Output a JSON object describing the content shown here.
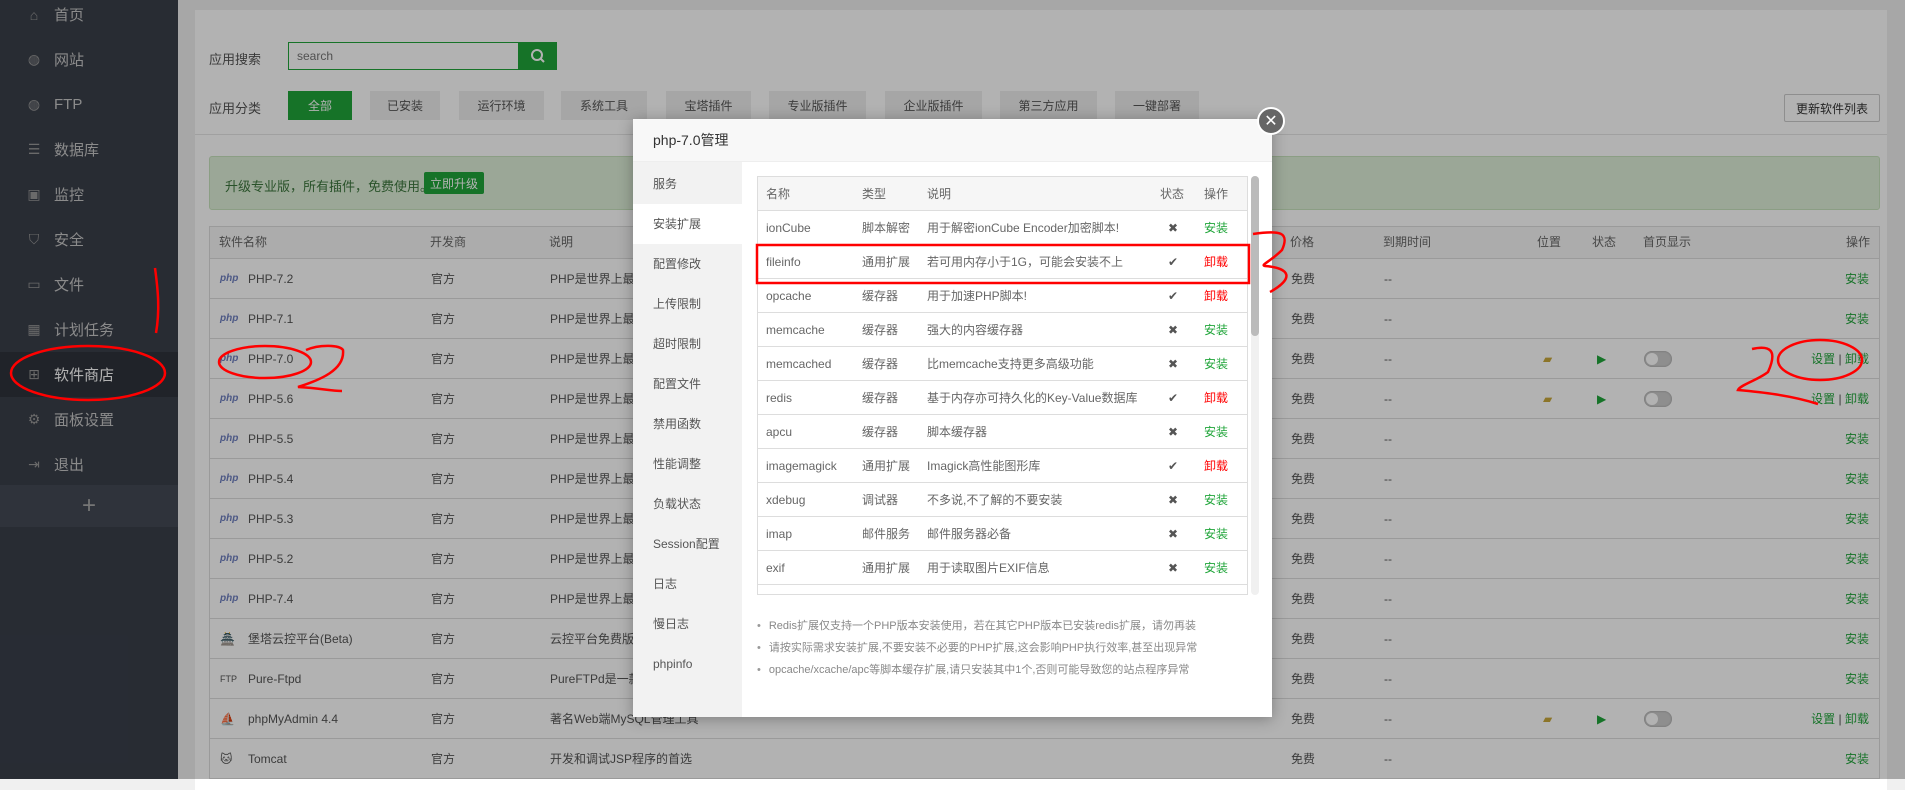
{
  "sidebar": {
    "items": [
      {
        "label": "首页",
        "icon": "home-icon",
        "glyph": "⌂"
      },
      {
        "label": "网站",
        "icon": "globe-icon",
        "glyph": "◍"
      },
      {
        "label": "FTP",
        "icon": "ftp-icon",
        "glyph": "◍"
      },
      {
        "label": "数据库",
        "icon": "database-icon",
        "glyph": "☰"
      },
      {
        "label": "监控",
        "icon": "monitor-icon",
        "glyph": "▣"
      },
      {
        "label": "安全",
        "icon": "shield-icon",
        "glyph": "⛉"
      },
      {
        "label": "文件",
        "icon": "folder-icon",
        "glyph": "▭"
      },
      {
        "label": "计划任务",
        "icon": "calendar-icon",
        "glyph": "▦"
      },
      {
        "label": "软件商店",
        "icon": "apps-grid-icon",
        "glyph": "⊞",
        "active": true
      },
      {
        "label": "面板设置",
        "icon": "gear-icon",
        "glyph": "⚙"
      },
      {
        "label": "退出",
        "icon": "logout-icon",
        "glyph": "⇥"
      }
    ],
    "add_label": "+"
  },
  "search": {
    "label": "应用搜索",
    "placeholder": "search"
  },
  "categories": {
    "label": "应用分类",
    "items": [
      "全部",
      "已安装",
      "运行环境",
      "系统工具",
      "宝塔插件",
      "专业版插件",
      "企业版插件",
      "第三方应用",
      "一键部署"
    ],
    "active": "全部"
  },
  "update_button": "更新软件列表",
  "banner": {
    "text": "升级专业版，所有插件，免费使用。",
    "button": "立即升级"
  },
  "table": {
    "headers": {
      "name": "软件名称",
      "developer": "开发商",
      "description": "说明",
      "price": "价格",
      "expiry": "到期时间",
      "location": "位置",
      "status": "状态",
      "homepage": "首页显示",
      "action": "操作"
    },
    "rows": [
      {
        "icon": "php",
        "name": "PHP-7.2",
        "developer": "官方",
        "description": "PHP是世界上最",
        "price": "免费",
        "expiry": "--",
        "action": "安装"
      },
      {
        "icon": "php",
        "name": "PHP-7.1",
        "developer": "官方",
        "description": "PHP是世界上最",
        "price": "免费",
        "expiry": "--",
        "action": "安装"
      },
      {
        "icon": "php",
        "name": "PHP-7.0",
        "developer": "官方",
        "description": "PHP是世界上最",
        "price": "免费",
        "expiry": "--",
        "installed": true,
        "settings": "设置",
        "uninstall": "卸载"
      },
      {
        "icon": "php",
        "name": "PHP-5.6",
        "developer": "官方",
        "description": "PHP是世界上最",
        "price": "免费",
        "expiry": "--",
        "installed": true,
        "settings": "设置",
        "uninstall": "卸载"
      },
      {
        "icon": "php",
        "name": "PHP-5.5",
        "developer": "官方",
        "description": "PHP是世界上最",
        "price": "免费",
        "expiry": "--",
        "action": "安装"
      },
      {
        "icon": "php",
        "name": "PHP-5.4",
        "developer": "官方",
        "description": "PHP是世界上最",
        "price": "免费",
        "expiry": "--",
        "action": "安装"
      },
      {
        "icon": "php",
        "name": "PHP-5.3",
        "developer": "官方",
        "description": "PHP是世界上最",
        "price": "免费",
        "expiry": "--",
        "action": "安装"
      },
      {
        "icon": "php",
        "name": "PHP-5.2",
        "developer": "官方",
        "description": "PHP是世界上最",
        "price": "免费",
        "expiry": "--",
        "action": "安装"
      },
      {
        "icon": "php",
        "name": "PHP-7.4",
        "developer": "官方",
        "description": "PHP是世界上最",
        "price": "免费",
        "expiry": "--",
        "action": "安装"
      },
      {
        "icon": "pagoda",
        "name": "堡塔云控平台(Beta)",
        "developer": "官方",
        "description": "云控平台免费版",
        "price": "免费",
        "expiry": "--",
        "action": "安装"
      },
      {
        "icon": "ftp",
        "name": "Pure-Ftpd",
        "developer": "官方",
        "description": "PureFTPd是一款",
        "price": "免费",
        "expiry": "--",
        "action": "安装"
      },
      {
        "icon": "phpmyadmin",
        "name": "phpMyAdmin 4.4",
        "developer": "官方",
        "description": "著名Web端MySQL管理工具",
        "price": "免费",
        "expiry": "--",
        "installed": true,
        "settings": "设置",
        "uninstall": "卸载"
      },
      {
        "icon": "tomcat",
        "name": "Tomcat",
        "developer": "官方",
        "description": "开发和调试JSP程序的首选",
        "price": "免费",
        "expiry": "--",
        "action": "安装"
      }
    ]
  },
  "modal": {
    "title": "php-7.0管理",
    "menu": [
      "服务",
      "安装扩展",
      "配置修改",
      "上传限制",
      "超时限制",
      "配置文件",
      "禁用函数",
      "性能调整",
      "负载状态",
      "Session配置",
      "日志",
      "慢日志",
      "phpinfo"
    ],
    "active_menu": "安装扩展",
    "ext_headers": {
      "name": "名称",
      "type": "类型",
      "desc": "说明",
      "status": "状态",
      "op": "操作"
    },
    "extensions": [
      {
        "name": "ionCube",
        "type": "脚本解密",
        "desc": "用于解密ionCube Encoder加密脚本!",
        "installed": false,
        "op": "安装"
      },
      {
        "name": "fileinfo",
        "type": "通用扩展",
        "desc": "若可用内存小于1G，可能会安装不上",
        "installed": true,
        "op": "卸载"
      },
      {
        "name": "opcache",
        "type": "缓存器",
        "desc": "用于加速PHP脚本!",
        "installed": true,
        "op": "卸载"
      },
      {
        "name": "memcache",
        "type": "缓存器",
        "desc": "强大的内容缓存器",
        "installed": false,
        "op": "安装"
      },
      {
        "name": "memcached",
        "type": "缓存器",
        "desc": "比memcache支持更多高级功能",
        "installed": false,
        "op": "安装"
      },
      {
        "name": "redis",
        "type": "缓存器",
        "desc": "基于内存亦可持久化的Key-Value数据库",
        "installed": true,
        "op": "卸载"
      },
      {
        "name": "apcu",
        "type": "缓存器",
        "desc": "脚本缓存器",
        "installed": false,
        "op": "安装"
      },
      {
        "name": "imagemagick",
        "type": "通用扩展",
        "desc": "Imagick高性能图形库",
        "installed": true,
        "op": "卸载"
      },
      {
        "name": "xdebug",
        "type": "调试器",
        "desc": "不多说,不了解的不要安装",
        "installed": false,
        "op": "安装"
      },
      {
        "name": "imap",
        "type": "邮件服务",
        "desc": "邮件服务器必备",
        "installed": false,
        "op": "安装"
      },
      {
        "name": "exif",
        "type": "通用扩展",
        "desc": "用于读取图片EXIF信息",
        "installed": false,
        "op": "安装"
      }
    ],
    "notes": [
      "Redis扩展仅支持一个PHP版本安装使用，若在其它PHP版本已安装redis扩展，请勿再装",
      "请按实际需求安装扩展,不要安装不必要的PHP扩展,这会影响PHP执行效率,甚至出现异常",
      "opcache/xcache/apc等脚本缓存扩展,请只安装其中1个,否则可能导致您的站点程序异常"
    ]
  },
  "colors": {
    "accent": "#20a53a",
    "danger": "#ff0000",
    "annotation": "#ff0000"
  }
}
